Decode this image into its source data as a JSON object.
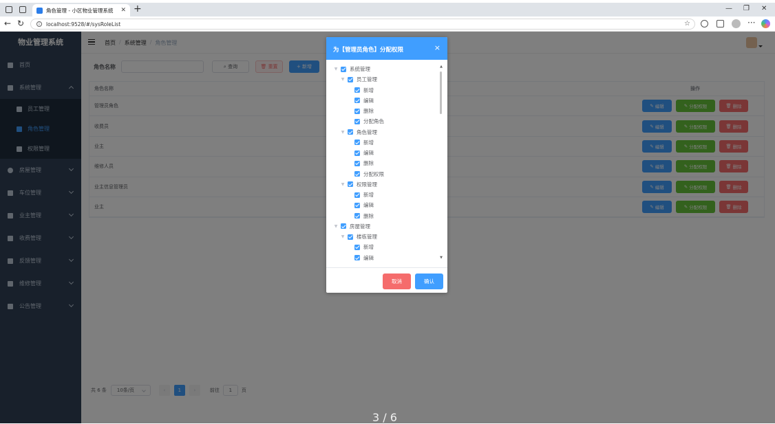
{
  "browser": {
    "tab_title": "角色管理 - 小区物业管理系统",
    "url": "localhost:9528/#/sysRoleList"
  },
  "sidebar": {
    "brand": "物业管理系统",
    "menu": [
      {
        "label": "首页"
      },
      {
        "label": "系统管理"
      },
      {
        "label": "房屋管理"
      },
      {
        "label": "车位管理"
      },
      {
        "label": "业主管理"
      },
      {
        "label": "收费管理"
      },
      {
        "label": "反馈管理"
      },
      {
        "label": "维修管理"
      },
      {
        "label": "公告管理"
      }
    ],
    "submenu": [
      {
        "label": "员工管理"
      },
      {
        "label": "角色管理"
      },
      {
        "label": "权限管理"
      }
    ]
  },
  "navbar": {
    "breadcrumb": [
      "首页",
      "系统管理",
      "角色管理"
    ],
    "separator": "/"
  },
  "search": {
    "label": "角色名称",
    "query_button": "查询",
    "reset_button": "重置",
    "add_button": "新增"
  },
  "table": {
    "headers": {
      "name": "角色名称",
      "ops": "操作"
    },
    "rows": [
      {
        "name": "管理员角色"
      },
      {
        "name": "收费员"
      },
      {
        "name": "业主"
      },
      {
        "name": "维修人员"
      },
      {
        "name": "业主信息管理员"
      },
      {
        "name": "业主"
      }
    ],
    "op_edit": "编辑",
    "op_perm": "分配权限",
    "op_delete": "删除"
  },
  "pagination": {
    "total": "共 6 条",
    "page_size": "10条/页",
    "current_page": "1",
    "goto_label": "前往",
    "goto_value": "1",
    "page_suffix": "页"
  },
  "dialog": {
    "title": "为【管理员角色】分配权限",
    "close": "×",
    "cancel": "取消",
    "confirm": "确认",
    "tree": [
      {
        "label": "系统管理",
        "level": 0,
        "expanded": true
      },
      {
        "label": "员工管理",
        "level": 1,
        "expanded": true
      },
      {
        "label": "新增",
        "level": 2
      },
      {
        "label": "编辑",
        "level": 2
      },
      {
        "label": "删除",
        "level": 2
      },
      {
        "label": "分配角色",
        "level": 2
      },
      {
        "label": "角色管理",
        "level": 1,
        "expanded": true
      },
      {
        "label": "新增",
        "level": 2
      },
      {
        "label": "编辑",
        "level": 2
      },
      {
        "label": "删除",
        "level": 2
      },
      {
        "label": "分配权限",
        "level": 2
      },
      {
        "label": "权限管理",
        "level": 1,
        "expanded": true
      },
      {
        "label": "新增",
        "level": 2
      },
      {
        "label": "编辑",
        "level": 2
      },
      {
        "label": "删除",
        "level": 2
      },
      {
        "label": "房屋管理",
        "level": 0,
        "expanded": true
      },
      {
        "label": "楼栋管理",
        "level": 1,
        "expanded": true
      },
      {
        "label": "新增",
        "level": 2
      },
      {
        "label": "编辑",
        "level": 2
      }
    ]
  },
  "page_indicator": "3 / 6",
  "colors": {
    "primary": "#409eff",
    "success": "#67c23a",
    "danger": "#f56c6c",
    "sidebar": "#304156"
  }
}
